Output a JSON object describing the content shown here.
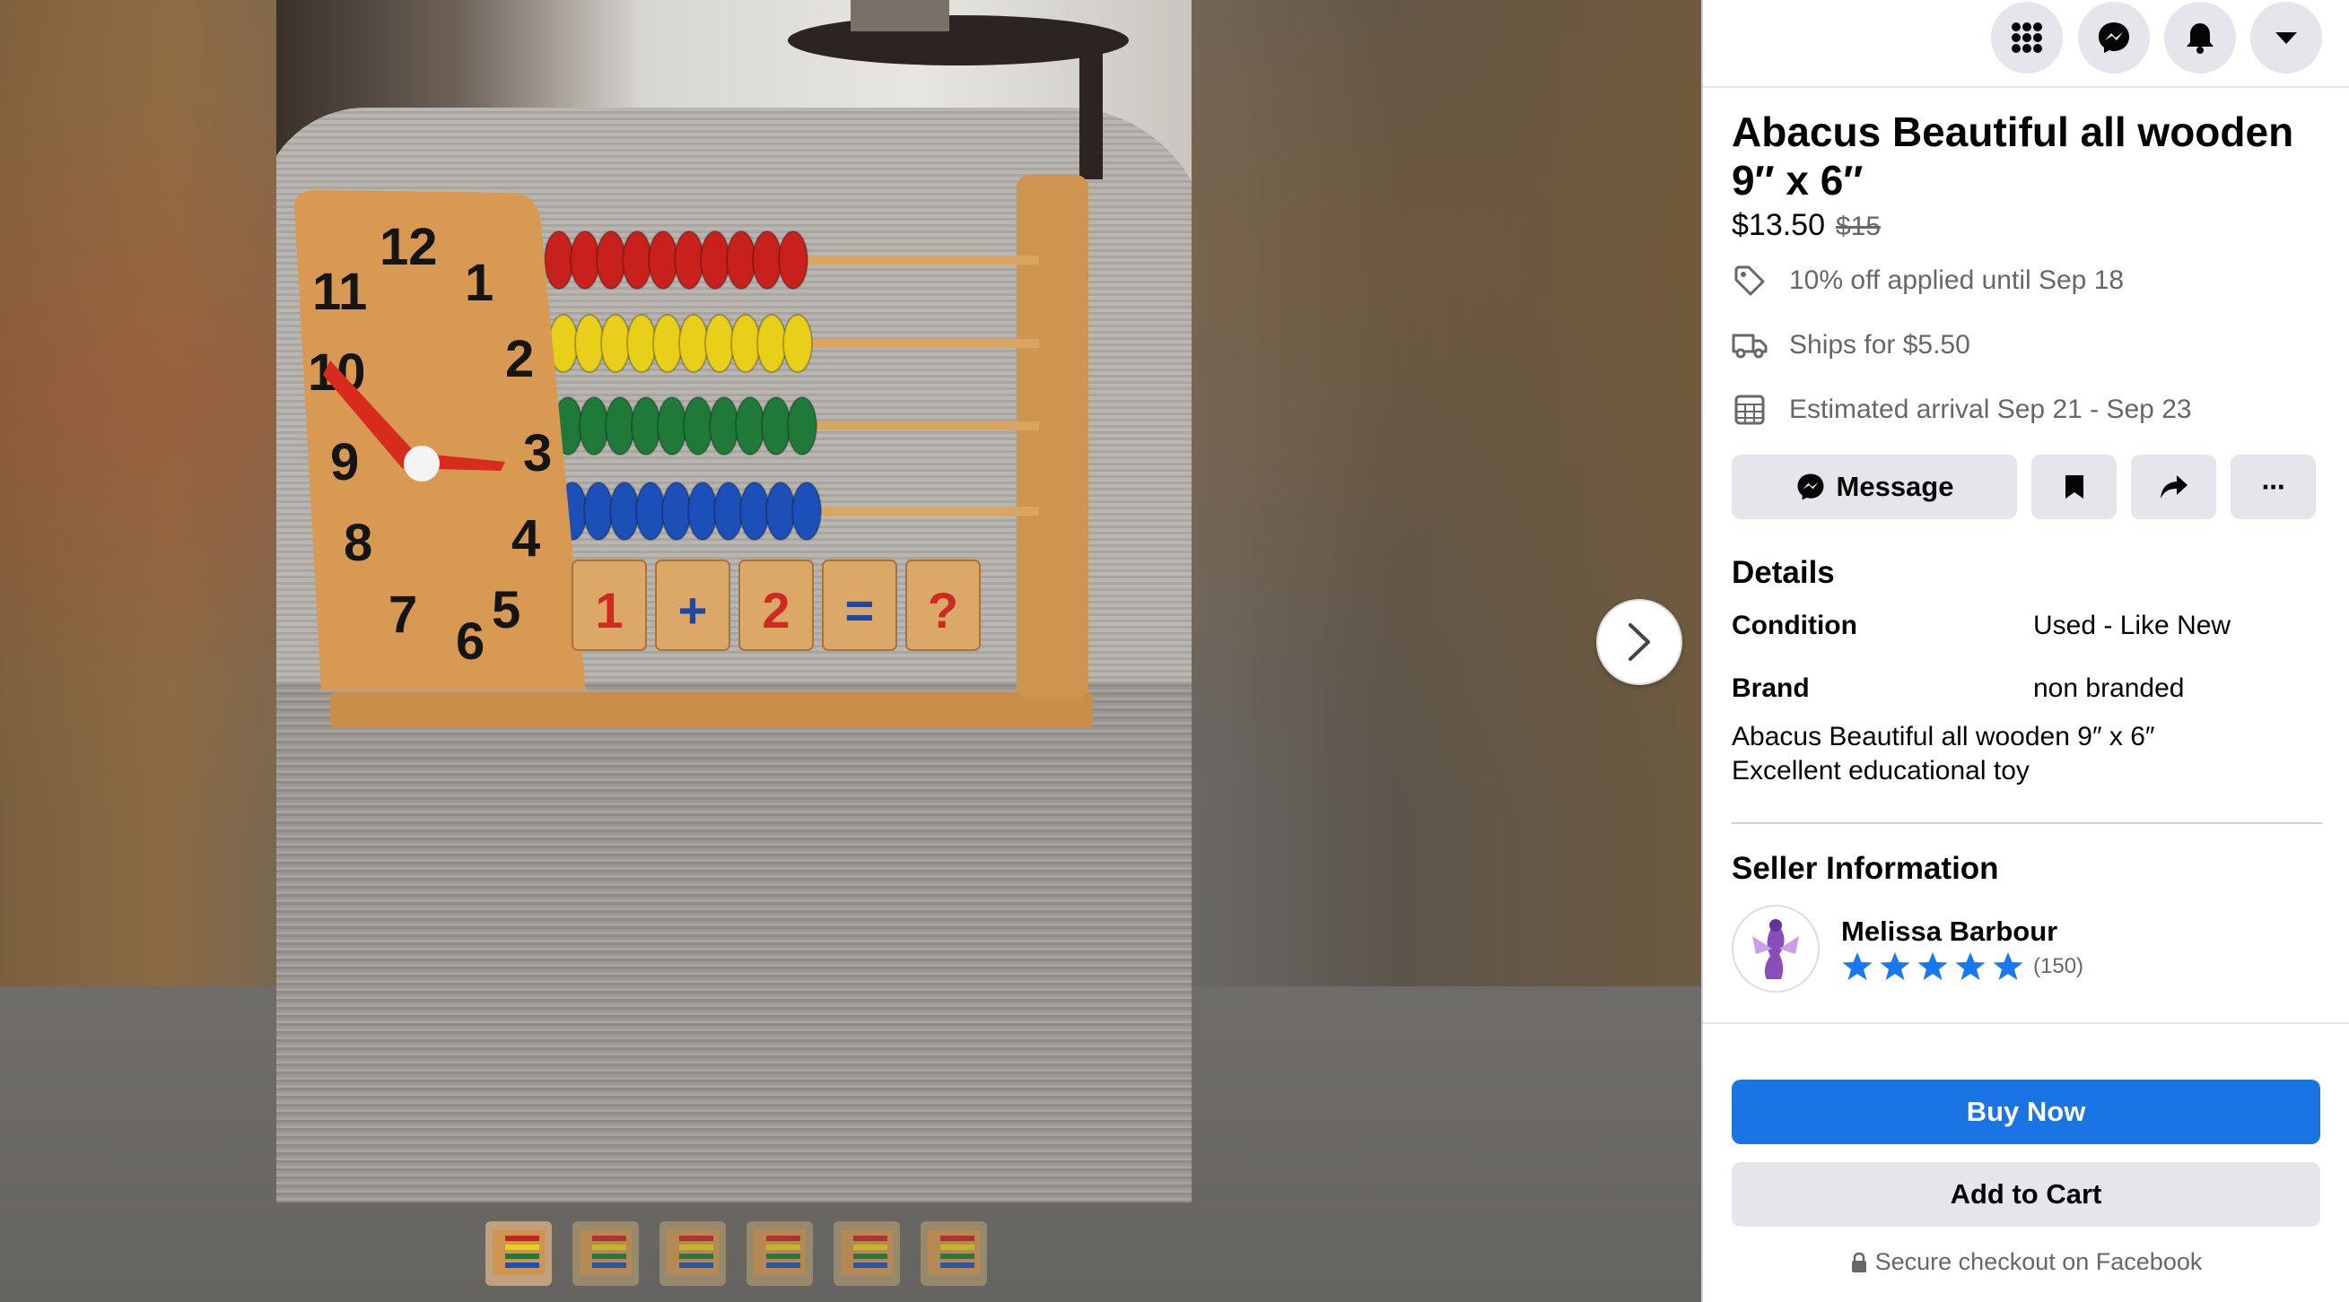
{
  "listing": {
    "title": "Abacus Beautiful all wooden 9″ x 6″",
    "price": "$13.50",
    "original_price": "$15",
    "discount_text": "10% off applied until Sep 18",
    "shipping_text": "Ships for $5.50",
    "arrival_text": "Estimated arrival Sep 21 - Sep 23"
  },
  "actions": {
    "message_label": "Message",
    "save_icon": "bookmark-icon",
    "share_icon": "share-icon",
    "more_label": "···"
  },
  "details": {
    "heading": "Details",
    "rows": [
      {
        "key": "Condition",
        "value": "Used - Like New"
      },
      {
        "key": "Brand",
        "value": "non branded"
      }
    ],
    "description_line1": "Abacus Beautiful all wooden 9″ x 6″",
    "description_line2": "Excellent educational toy"
  },
  "seller": {
    "heading": "Seller Information",
    "name": "Melissa Barbour",
    "rating_stars": 5,
    "rating_count": "(150)"
  },
  "checkout": {
    "buy_label": "Buy Now",
    "cart_label": "Add to Cart",
    "secure_text": "Secure checkout on Facebook"
  },
  "topbar_icons": [
    "menu-grid-icon",
    "messenger-icon",
    "notifications-bell-icon",
    "account-caret-icon"
  ],
  "photo": {
    "clock_numbers": [
      "12",
      "1",
      "2",
      "3",
      "4",
      "5",
      "6",
      "7",
      "8",
      "9",
      "10",
      "11"
    ],
    "bead_rows": [
      "#c8201c",
      "#e8cf1a",
      "#1f7a3a",
      "#1d4fb8"
    ],
    "cubes": [
      "1",
      "+",
      "2",
      "=",
      "?"
    ],
    "thumbnail_count": 6
  },
  "colors": {
    "primary": "#1b74e4",
    "secondary_button": "#e4e6eb",
    "star": "#1877f2"
  }
}
